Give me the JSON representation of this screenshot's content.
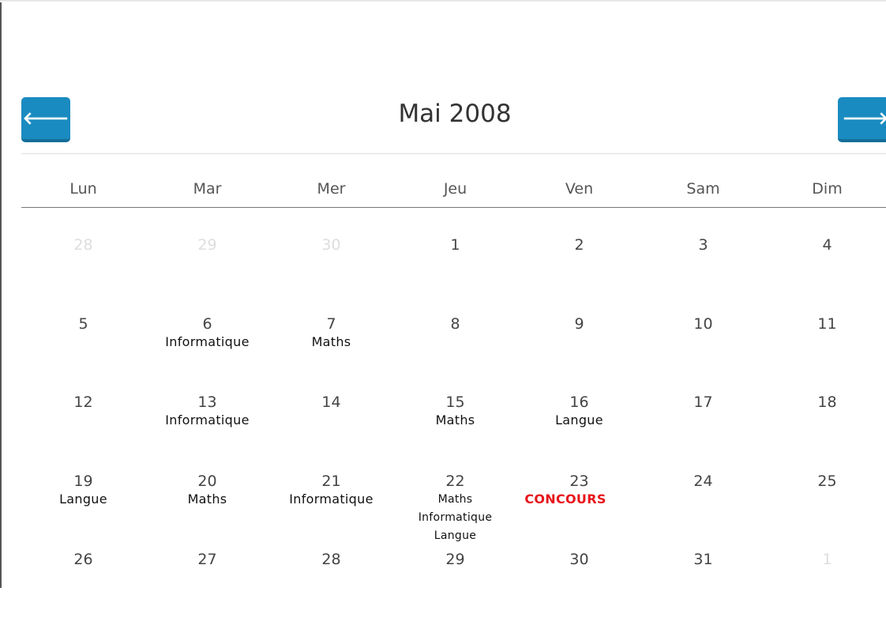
{
  "header": {
    "title": "Mai 2008",
    "prev_icon": "arrow-left-icon",
    "next_icon": "arrow-right-icon",
    "prev_glyph": "🡐",
    "next_glyph": "🡒"
  },
  "weekdays": [
    "Lun",
    "Mar",
    "Mer",
    "Jeu",
    "Ven",
    "Sam",
    "Dim"
  ],
  "accent_color": "#1a8bc0",
  "event_color": "#e8141b",
  "weeks": [
    [
      {
        "d": "28",
        "other": true
      },
      {
        "d": "29",
        "other": true
      },
      {
        "d": "30",
        "other": true
      },
      {
        "d": "1"
      },
      {
        "d": "2"
      },
      {
        "d": "3"
      },
      {
        "d": "4"
      }
    ],
    [
      {
        "d": "5"
      },
      {
        "d": "6",
        "notes": [
          "Informatique"
        ]
      },
      {
        "d": "7",
        "notes": [
          "Maths"
        ]
      },
      {
        "d": "8"
      },
      {
        "d": "9"
      },
      {
        "d": "10"
      },
      {
        "d": "11"
      }
    ],
    [
      {
        "d": "12"
      },
      {
        "d": "13",
        "notes": [
          "Informatique"
        ]
      },
      {
        "d": "14"
      },
      {
        "d": "15",
        "notes": [
          "Maths"
        ]
      },
      {
        "d": "16",
        "notes": [
          "Langue"
        ]
      },
      {
        "d": "17"
      },
      {
        "d": "18"
      }
    ],
    [
      {
        "d": "19",
        "notes": [
          "Langue"
        ]
      },
      {
        "d": "20",
        "notes": [
          "Maths"
        ]
      },
      {
        "d": "21",
        "notes": [
          "Informatique"
        ]
      },
      {
        "d": "22",
        "notes": [
          "Maths",
          "Informatique",
          "Langue"
        ]
      },
      {
        "d": "23",
        "notes": [
          "CONCOURS"
        ],
        "highlight": true
      },
      {
        "d": "24"
      },
      {
        "d": "25"
      }
    ],
    [
      {
        "d": "26"
      },
      {
        "d": "27"
      },
      {
        "d": "28"
      },
      {
        "d": "29"
      },
      {
        "d": "30"
      },
      {
        "d": "31"
      },
      {
        "d": "1",
        "other": true
      }
    ]
  ]
}
